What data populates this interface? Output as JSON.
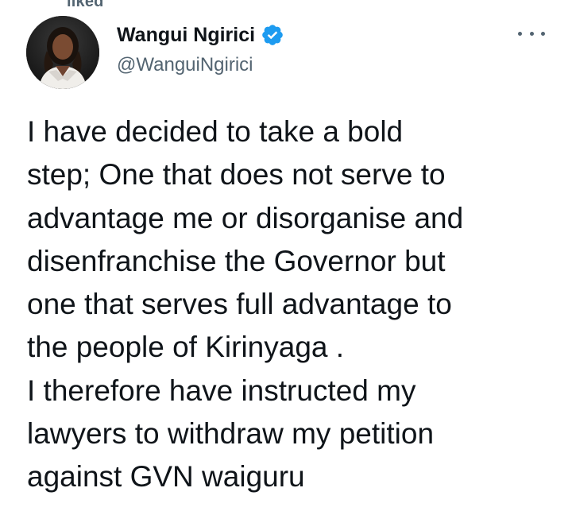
{
  "context": {
    "label": "liked"
  },
  "author": {
    "display_name": "Wangui Ngirici",
    "handle": "@WanguiNgirici",
    "verified_icon": "verified-badge-icon",
    "avatar_icon": "profile-photo-avatar"
  },
  "menu": {
    "icon": "more-options-icon"
  },
  "tweet": {
    "text": "I have decided to take a bold\nstep; One that does not serve to\nadvantage me or disorganise and\ndisenfranchise the Governor  but\none that serves  full advantage to\nthe people of Kirinyaga .\nI therefore have instructed my\nlawyers to withdraw my petition\nagainst GVN waiguru"
  },
  "colors": {
    "primary_text": "#0f1419",
    "secondary_text": "#536471",
    "verified_blue": "#1d9bf0",
    "background": "#ffffff"
  }
}
